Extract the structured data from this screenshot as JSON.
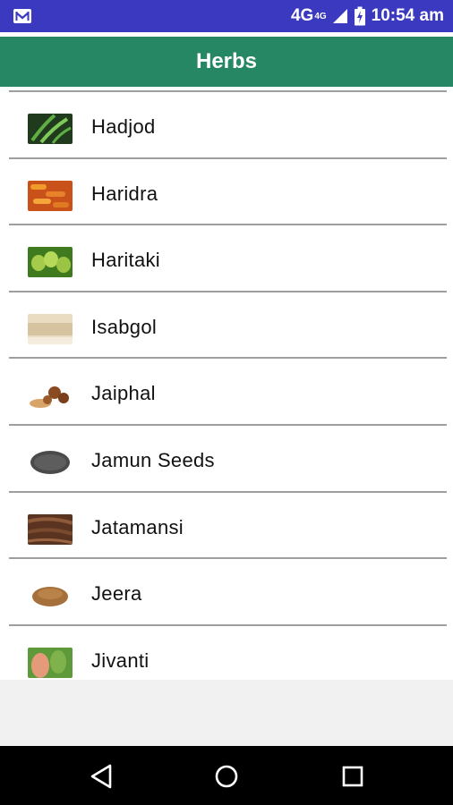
{
  "status_bar": {
    "network": "4G",
    "network_sup": "4G",
    "time": "10:54 am",
    "icons": [
      "mail-icon",
      "signal-icon",
      "battery-charging-icon"
    ]
  },
  "app_bar": {
    "title": "Herbs"
  },
  "herbs": [
    {
      "name": "Hadjod",
      "thumb_colors": [
        "#1f3a1c",
        "#5fae45"
      ]
    },
    {
      "name": "Haridra",
      "thumb_colors": [
        "#d9661a",
        "#f09a2a"
      ]
    },
    {
      "name": "Haritaki",
      "thumb_colors": [
        "#3f7a1f",
        "#a4cc4a"
      ]
    },
    {
      "name": "Isabgol",
      "thumb_colors": [
        "#e9dcc0",
        "#c9b28b"
      ]
    },
    {
      "name": "Jaiphal",
      "thumb_colors": [
        "#f3e6d6",
        "#8a4a22"
      ]
    },
    {
      "name": "Jamun Seeds",
      "thumb_colors": [
        "#ffffff",
        "#4a4a4a"
      ]
    },
    {
      "name": "Jatamansi",
      "thumb_colors": [
        "#5a3420",
        "#8e5a3a"
      ]
    },
    {
      "name": "Jeera",
      "thumb_colors": [
        "#ffffff",
        "#a5703a"
      ]
    },
    {
      "name": "Jivanti",
      "thumb_colors": [
        "#5f9a3a",
        "#e59a7a"
      ]
    }
  ],
  "nav_bar": {
    "icons": [
      "back-icon",
      "home-icon",
      "recents-icon"
    ]
  }
}
